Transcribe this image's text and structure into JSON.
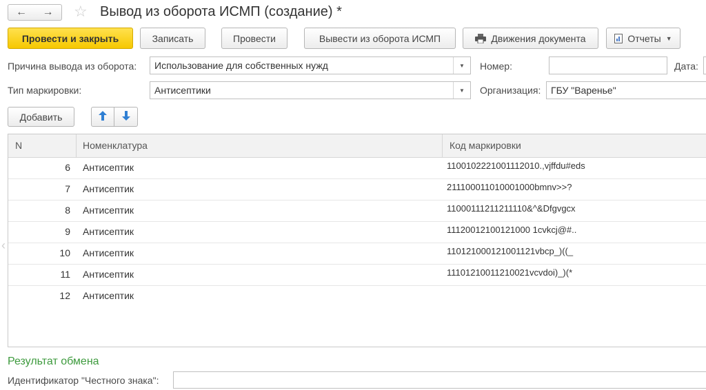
{
  "window": {
    "title": "Вывод из оборота ИСМП (создание) *",
    "icons": {
      "back": "arrow-left-icon",
      "forward": "arrow-right-icon",
      "favorite": "star-icon"
    }
  },
  "toolbar": {
    "post_close": "Провести и закрыть",
    "save": "Записать",
    "post": "Провести",
    "withdraw": "Вывести из оборота ИСМП",
    "movements": "Движения документа",
    "reports": "Отчеты"
  },
  "form": {
    "reason_label": "Причина вывода из оборота:",
    "reason_value": "Использование для собственных нужд",
    "number_label": "Номер:",
    "number_value": "",
    "date_label": "Дата:",
    "marking_type_label": "Тип маркировки:",
    "marking_type_value": "Антисептики",
    "org_label": "Организация:",
    "org_value": "ГБУ \"Варенье\""
  },
  "table_toolbar": {
    "add": "Добавить"
  },
  "table": {
    "columns": [
      "N",
      "Номенклатура",
      "Код маркировки"
    ],
    "rows": [
      {
        "n": "6",
        "nom": "Антисептик",
        "code": "1100102221001112010.,vjffdu#eds"
      },
      {
        "n": "7",
        "nom": "Антисептик",
        "code": "211100011010001000bmnv>>?"
      },
      {
        "n": "8",
        "nom": "Антисептик",
        "code": "11000111211211110&^&Dfgvgcx"
      },
      {
        "n": "9",
        "nom": "Антисептик",
        "code": "11120012100121000 1cvkcj@#.."
      },
      {
        "n": "10",
        "nom": "Антисептик",
        "code": "110121000121001121vbcp_)((_"
      },
      {
        "n": "11",
        "nom": "Антисептик",
        "code": "11101210011210021vcvdoi)_)(*"
      },
      {
        "n": "12",
        "nom": "Антисептик",
        "code": ""
      }
    ]
  },
  "exchange": {
    "section_title": "Результат обмена",
    "id_label": "Идентификатор \"Честного знака\":",
    "id_value": ""
  },
  "colors": {
    "primary_button": "#f6c800",
    "section_green": "#3d9a3d",
    "arrow_blue": "#2f7fd3"
  }
}
